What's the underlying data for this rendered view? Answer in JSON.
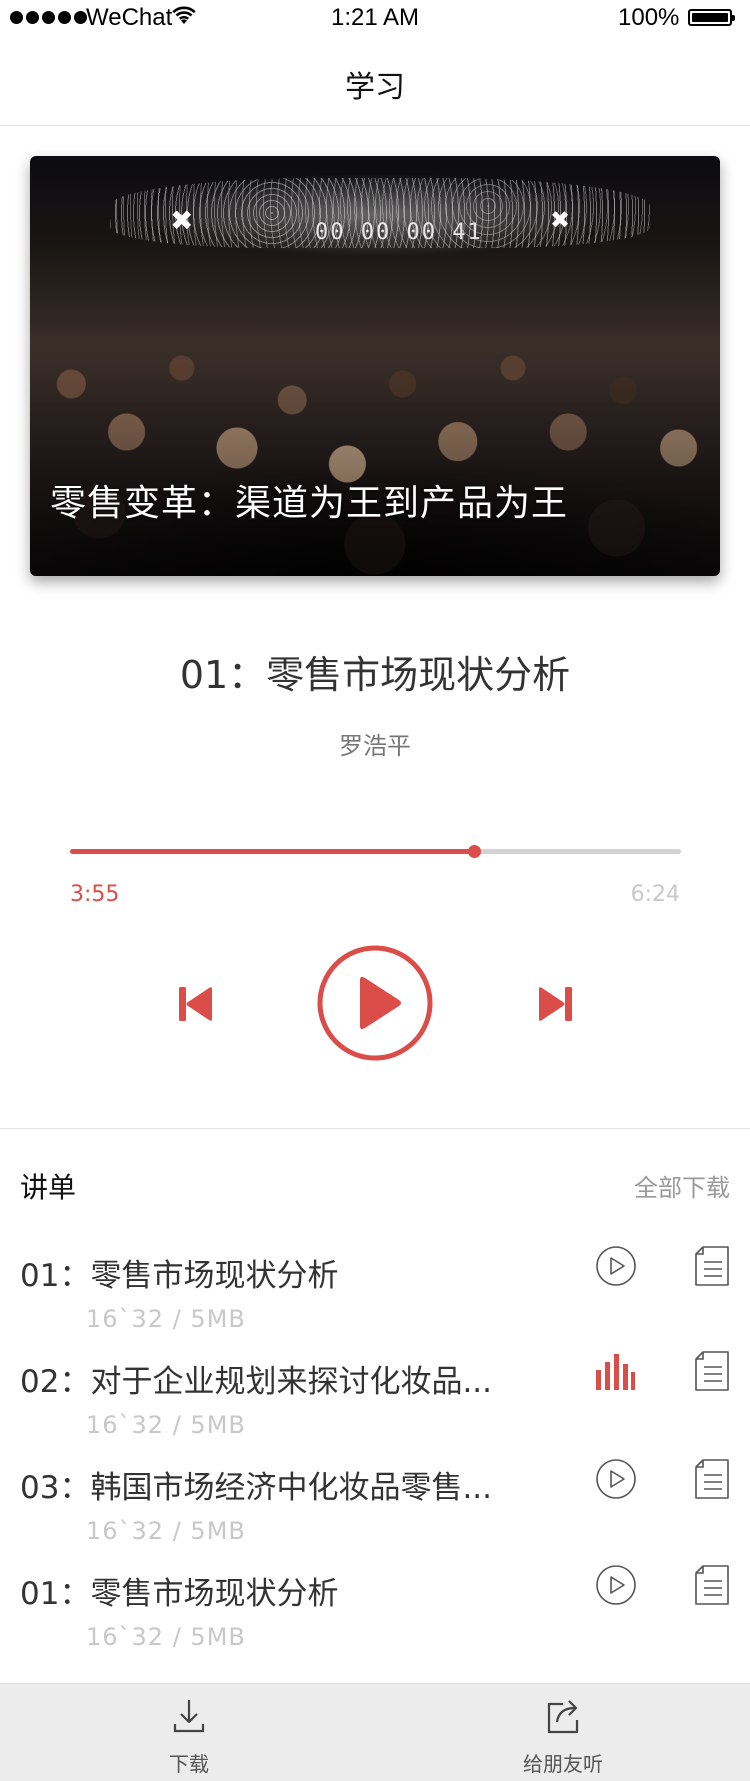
{
  "status_bar": {
    "carrier": "WeChat",
    "time": "1:21 AM",
    "battery": "100%"
  },
  "nav": {
    "title": "学习"
  },
  "hero": {
    "title": "零售变革：渠道为王到产品为王",
    "timer": "00 00 00 41"
  },
  "track": {
    "title": "01：零售市场现状分析",
    "author": "罗浩平",
    "current_time": "3:55",
    "total_time": "6:24",
    "progress": 0.662
  },
  "playlist": {
    "title": "讲单",
    "download_all": "全部下载",
    "items": [
      {
        "title": "01：零售市场现状分析",
        "meta": "16`32 / 5MB",
        "state": "play"
      },
      {
        "title": "02：对于企业规划来探讨化妆品...",
        "meta": "16`32 / 5MB",
        "state": "playing"
      },
      {
        "title": "03：韩国市场经济中化妆品零售...",
        "meta": "16`32 / 5MB",
        "state": "play"
      },
      {
        "title": "01：零售市场现状分析",
        "meta": "16`32 / 5MB",
        "state": "play"
      }
    ]
  },
  "bottom_bar": {
    "download": "下载",
    "share": "给朋友听"
  },
  "colors": {
    "accent": "#db4d48",
    "muted": "#c8c8c8"
  }
}
